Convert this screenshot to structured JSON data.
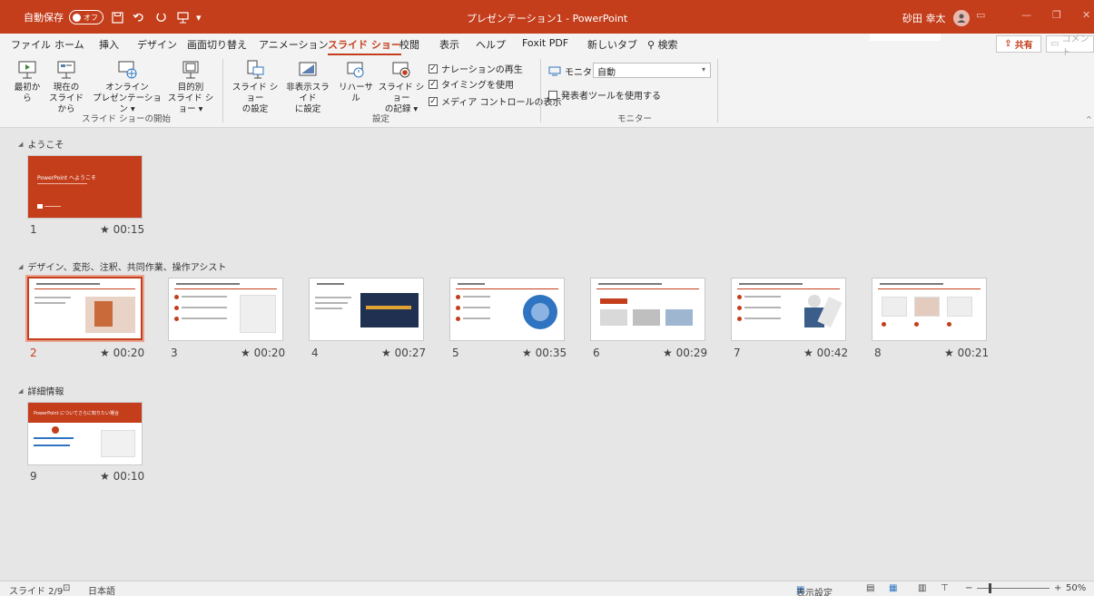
{
  "titlebar": {
    "autosave_label": "自動保存",
    "autosave_state": "オフ",
    "title": "プレゼンテーション1 - PowerPoint",
    "user": "砂田 幸太"
  },
  "tabs": [
    "ファイル",
    "ホーム",
    "挿入",
    "デザイン",
    "画面切り替え",
    "アニメーション",
    "スライド ショー",
    "校閲",
    "表示",
    "ヘルプ",
    "Foxit PDF",
    "新しいタブ",
    "検索"
  ],
  "active_tab": "スライド ショー",
  "share_label": "共有",
  "comment_label": "コメント",
  "ribbon": {
    "from_start": "最初から",
    "from_current_1": "現在の",
    "from_current_2": "スライドから",
    "online_1": "オンライン",
    "online_2": "プレゼンテーション ▾",
    "custom_1": "目的別",
    "custom_2": "スライド ショー ▾",
    "group_start": "スライド ショーの開始",
    "setup_1": "スライド ショー",
    "setup_2": "の設定",
    "hide_1": "非表示スライド",
    "hide_2": "に設定",
    "rehearse": "リハーサル",
    "record_1": "スライド ショー",
    "record_2": "の記録 ▾",
    "chk_narration": "ナレーションの再生",
    "chk_timing": "タイミングを使用",
    "chk_media": "メディア コントロールの表示",
    "group_setup": "設定",
    "monitor_label": "モニター:",
    "monitor_value": "自動",
    "presenter_view": "発表者ツールを使用する",
    "group_monitor": "モニター"
  },
  "sections": [
    {
      "title": "ようこそ"
    },
    {
      "title": "デザイン、変形、注釈、共同作業、操作アシスト"
    },
    {
      "title": "詳細情報"
    }
  ],
  "slides": [
    {
      "num": "1",
      "time": "00:15",
      "title_text": "PowerPoint へようこそ"
    },
    {
      "num": "2",
      "time": "00:20"
    },
    {
      "num": "3",
      "time": "00:20"
    },
    {
      "num": "4",
      "time": "00:27"
    },
    {
      "num": "5",
      "time": "00:35"
    },
    {
      "num": "6",
      "time": "00:29"
    },
    {
      "num": "7",
      "time": "00:42"
    },
    {
      "num": "8",
      "time": "00:21"
    },
    {
      "num": "9",
      "time": "00:10",
      "title_text": "PowerPoint についてさらに知りたい場合"
    }
  ],
  "selected_slide": "2",
  "time_marker": "★",
  "status": {
    "slide": "スライド 2/9",
    "language": "日本語",
    "display_settings": "表示設定",
    "zoom": "50%"
  },
  "colors": {
    "accent": "#c43e1c",
    "background": "#e6e6e6"
  }
}
